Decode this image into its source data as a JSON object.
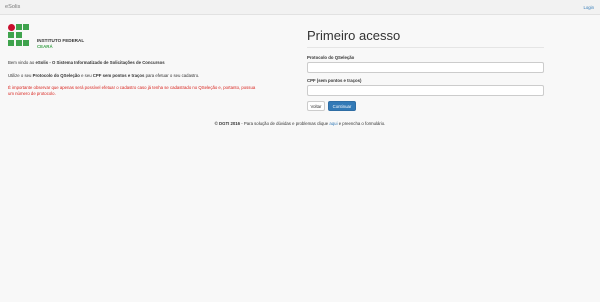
{
  "navbar": {
    "brand": "eSolis",
    "login_label": "Login"
  },
  "logo": {
    "institute": "INSTITUTO FEDERAL",
    "campus": "CEARÁ"
  },
  "intro": {
    "welcome_prefix": "Bem vindo ao ",
    "welcome_strong": "eSolis - O Sistema Informatizado de Solicitações de Concursos",
    "usage_prefix": "Utilize o seu ",
    "usage_strong1": "Protocolo do QSeleção",
    "usage_mid": " e seu ",
    "usage_strong2": "CPF sem pontos e traços",
    "usage_suffix": " para efetuar o seu cadastro.",
    "warning": "É importante observar que apenas será possível efetuar o cadastro caso já tenha se cadastrado no QSeleção e, portanto, possua um número de protocolo."
  },
  "form": {
    "title": "Primeiro acesso",
    "protocol_label": "Protocolo do QSeleção",
    "protocol_value": "",
    "cpf_label": "CPF (sem pontos e traços)",
    "cpf_value": "",
    "back_label": "Voltar",
    "continue_label": "Continuar"
  },
  "footer": {
    "copyright": "© DGTI 2016",
    "text_before": " - Para solução de dúvidas e problemas clique ",
    "link": "aqui",
    "text_after": " e preencha o formulário."
  },
  "colors": {
    "green": "#3fa34d",
    "red": "#c8102e",
    "link": "#337ab7",
    "warning": "#d9231d"
  }
}
